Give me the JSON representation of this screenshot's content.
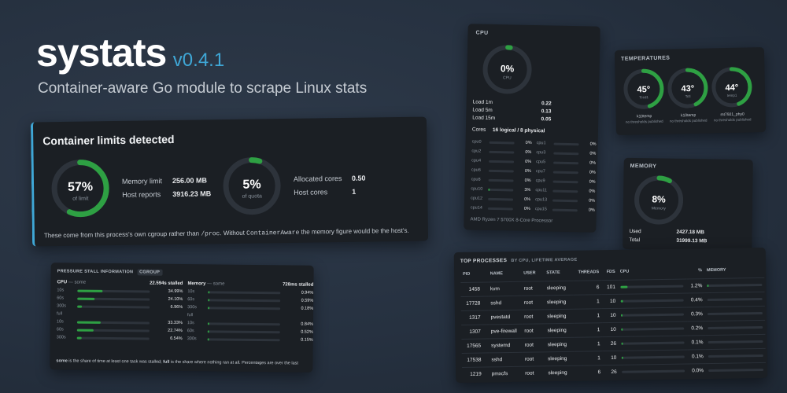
{
  "hero": {
    "name": "systats",
    "version": "v0.4.1",
    "tagline": "Container-aware Go module to scrape Linux stats"
  },
  "container": {
    "title": "Container limits detected",
    "mem": {
      "pct": "57%",
      "sub": "of limit",
      "fraction": 0.57
    },
    "mem_limit_label": "Memory limit",
    "mem_limit_value": "256.00 MB",
    "host_reports_label": "Host reports",
    "host_reports_value": "3916.23 MB",
    "quota": {
      "pct": "5%",
      "sub": "of quota",
      "fraction": 0.05
    },
    "alloc_label": "Allocated cores",
    "alloc_value": "0.50",
    "host_cores_label": "Host cores",
    "host_cores_value": "1",
    "note_1": "These come from this process's own cgroup rather than ",
    "note_code1": "/proc",
    "note_2": ". Without ",
    "note_code2": "ContainerAware",
    "note_3": " the memory figure would be the host's."
  },
  "cpu": {
    "title": "CPU",
    "pct": "0%",
    "sub": "CPU",
    "fraction": 0.02,
    "load": [
      {
        "label": "Load 1m",
        "value": "0.22"
      },
      {
        "label": "Load 5m",
        "value": "0.13"
      },
      {
        "label": "Load 15m",
        "value": "0.05"
      }
    ],
    "cores_label": "Cores",
    "cores_value": "16 logical / 8 physical",
    "cores": [
      {
        "name": "cpu0",
        "pct": "0%",
        "f": 0
      },
      {
        "name": "cpu1",
        "pct": "0%",
        "f": 0
      },
      {
        "name": "cpu2",
        "pct": "0%",
        "f": 0
      },
      {
        "name": "cpu3",
        "pct": "0%",
        "f": 0
      },
      {
        "name": "cpu4",
        "pct": "0%",
        "f": 0
      },
      {
        "name": "cpu5",
        "pct": "0%",
        "f": 0
      },
      {
        "name": "cpu6",
        "pct": "0%",
        "f": 0
      },
      {
        "name": "cpu7",
        "pct": "0%",
        "f": 0
      },
      {
        "name": "cpu8",
        "pct": "0%",
        "f": 0
      },
      {
        "name": "cpu9",
        "pct": "0%",
        "f": 0
      },
      {
        "name": "cpu10",
        "pct": "3%",
        "f": 0.03
      },
      {
        "name": "cpu11",
        "pct": "0%",
        "f": 0
      },
      {
        "name": "cpu12",
        "pct": "0%",
        "f": 0
      },
      {
        "name": "cpu13",
        "pct": "0%",
        "f": 0
      },
      {
        "name": "cpu14",
        "pct": "0%",
        "f": 0
      },
      {
        "name": "cpu15",
        "pct": "0%",
        "f": 0
      }
    ],
    "model": "AMD Ryzen 7 5700X 8-Core Processor"
  },
  "temps": {
    "title": "Temperatures",
    "items": [
      {
        "value": "45°",
        "name": "Tccd1",
        "chip": "k10temp",
        "note": "no thresholds published",
        "fraction": 0.45
      },
      {
        "value": "43°",
        "name": "Tctl",
        "chip": "k10temp",
        "note": "no thresholds published",
        "fraction": 0.43
      },
      {
        "value": "44°",
        "name": "temp1",
        "chip": "mt7921_phy0",
        "note": "no thresholds published",
        "fraction": 0.44
      }
    ]
  },
  "memory": {
    "title": "Memory",
    "pct": "8%",
    "sub": "Memory",
    "fraction": 0.08,
    "used_label": "Used",
    "used_value": "2427.18 MB",
    "total_label": "Total",
    "total_value": "31999.13 MB"
  },
  "psi": {
    "title": "Pressure stall information",
    "badge": "cgroup",
    "cpu_head": "CPU",
    "cpu_kind": "— some",
    "cpu_stalled": "22.594s stalled",
    "cpu_some": [
      {
        "l": "10s",
        "v": "34.99%",
        "f": 0.35
      },
      {
        "l": "60s",
        "v": "24.10%",
        "f": 0.24
      },
      {
        "l": "300s",
        "v": "6.96%",
        "f": 0.07
      }
    ],
    "full_label": "full",
    "cpu_full": [
      {
        "l": "10s",
        "v": "33.33%",
        "f": 0.33
      },
      {
        "l": "60s",
        "v": "22.74%",
        "f": 0.23
      },
      {
        "l": "300s",
        "v": "6.54%",
        "f": 0.065
      }
    ],
    "mem_head": "Memory",
    "mem_kind": "— some",
    "mem_stalled": "728ms stalled",
    "mem_some": [
      {
        "l": "10s",
        "v": "0.94%",
        "f": 0.01
      },
      {
        "l": "60s",
        "v": "0.59%",
        "f": 0.006
      },
      {
        "l": "300s",
        "v": "0.18%",
        "f": 0.002
      }
    ],
    "mem_full": [
      {
        "l": "10s",
        "v": "0.84%",
        "f": 0.01
      },
      {
        "l": "60s",
        "v": "0.52%",
        "f": 0.005
      },
      {
        "l": "300s",
        "v": "0.15%",
        "f": 0.002
      }
    ],
    "foot_b1": "some",
    "foot_t1": " is the share of time at least one task was stalled; ",
    "foot_b2": "full",
    "foot_t2": " is the share where nothing ran at all. Percentages are over the last"
  },
  "procs": {
    "title": "Top processes",
    "subtitle": "by CPU, lifetime average",
    "headers": [
      "PID",
      "NAME",
      "USER",
      "STATE",
      "THREADS",
      "FDS",
      "CPU",
      "%",
      "MEMORY"
    ],
    "rows": [
      {
        "pid": "1458",
        "name": "kvm",
        "user": "root",
        "state": "sleeping",
        "threads": "6",
        "fds": "101",
        "cpu": "1.2%",
        "cf": 0.012,
        "mf": 0.03
      },
      {
        "pid": "17728",
        "name": "sshd",
        "user": "root",
        "state": "sleeping",
        "threads": "1",
        "fds": "10",
        "cpu": "0.4%",
        "cf": 0.004,
        "mf": 0.0
      },
      {
        "pid": "1317",
        "name": "pvestatd",
        "user": "root",
        "state": "sleeping",
        "threads": "1",
        "fds": "10",
        "cpu": "0.3%",
        "cf": 0.003,
        "mf": 0.0
      },
      {
        "pid": "1307",
        "name": "pve-firewall",
        "user": "root",
        "state": "sleeping",
        "threads": "1",
        "fds": "10",
        "cpu": "0.2%",
        "cf": 0.002,
        "mf": 0.0
      },
      {
        "pid": "17565",
        "name": "systemd",
        "user": "root",
        "state": "sleeping",
        "threads": "1",
        "fds": "26",
        "cpu": "0.1%",
        "cf": 0.001,
        "mf": 0.0
      },
      {
        "pid": "17538",
        "name": "sshd",
        "user": "root",
        "state": "sleeping",
        "threads": "1",
        "fds": "10",
        "cpu": "0.1%",
        "cf": 0.001,
        "mf": 0.0
      },
      {
        "pid": "1219",
        "name": "pmxcfs",
        "user": "root",
        "state": "sleeping",
        "threads": "6",
        "fds": "26",
        "cpu": "0.0%",
        "cf": 0.0,
        "mf": 0.0
      }
    ]
  },
  "colors": {
    "accent": "#2ea043",
    "version": "#3fa7d6",
    "track": "#2d333b"
  }
}
